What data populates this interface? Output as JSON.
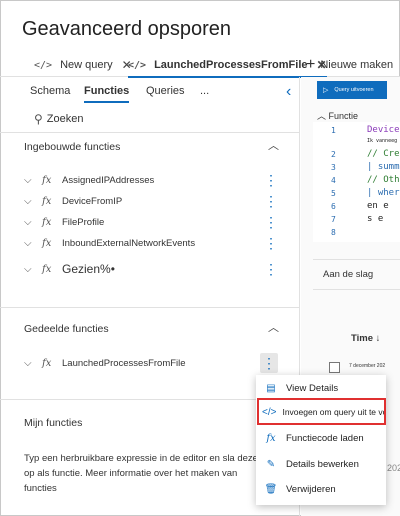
{
  "page": {
    "title": "Geavanceerd opsporen"
  },
  "tabs": [
    {
      "label": "New query",
      "icon": "code-icon"
    },
    {
      "label": "LaunchedProcessesFromFile",
      "icon": "code-icon",
      "active": true
    },
    {
      "label": "Nieuwe maken",
      "icon": "plus-icon"
    }
  ],
  "left_panel": {
    "subtabs": [
      "Schema",
      "Functies",
      "Queries",
      "..."
    ],
    "search_label": "Zoeken",
    "builtin": {
      "title": "Ingebouwde functies",
      "items": [
        "AssignedIPAddresses",
        "DeviceFromIP",
        "FileProfile",
        "InboundExternalNetworkEvents",
        "Gezien%•"
      ]
    },
    "shared": {
      "title": "Gedeelde functies",
      "items": [
        "LaunchedProcessesFromFile"
      ]
    },
    "mine": {
      "title": "Mijn functies",
      "description": "Typ een herbruikbare expressie in de editor en sla deze op als functie. Meer informatie over het maken van functies"
    }
  },
  "right_panel": {
    "run_button": "Query uitvoeren",
    "function_label": "Functie",
    "editor_lines": [
      {
        "n": "1",
        "text": "Device",
        "color": "#8a3ab9"
      },
      {
        "n": "",
        "text": "Ik vanneeg",
        "color": "#222"
      },
      {
        "n": "2",
        "text": "// Cre",
        "color": "#2e7d32"
      },
      {
        "n": "3",
        "text": "| summ",
        "color": "#2b6cb0"
      },
      {
        "n": "4",
        "text": "// Oth",
        "color": "#2e7d32"
      },
      {
        "n": "5",
        "text": "| wher",
        "color": "#2b6cb0"
      },
      {
        "n": "6",
        "text": "en  e",
        "color": "#222"
      },
      {
        "n": "7",
        "text": "s   e",
        "color": "#222"
      },
      {
        "n": "8",
        "text": "",
        "color": "#222"
      }
    ],
    "aan_de_slag": "Aan de slag",
    "time_column": "Time ↓",
    "date_cell": "7 december 202",
    "year_fragment": "202"
  },
  "context_menu": {
    "items": [
      {
        "label": "View Details",
        "icon": "view-details-icon"
      },
      {
        "label": "Invoegen om query uit te voeren",
        "icon": "insert-code-icon"
      },
      {
        "label": "Functiecode laden",
        "icon": "fx-icon"
      },
      {
        "label": "Details bewerken",
        "icon": "edit-details-icon"
      },
      {
        "label": "Verwijderen",
        "icon": "delete-icon"
      }
    ]
  },
  "colors": {
    "accent": "#0f6cbd",
    "highlight": "#e03030"
  }
}
